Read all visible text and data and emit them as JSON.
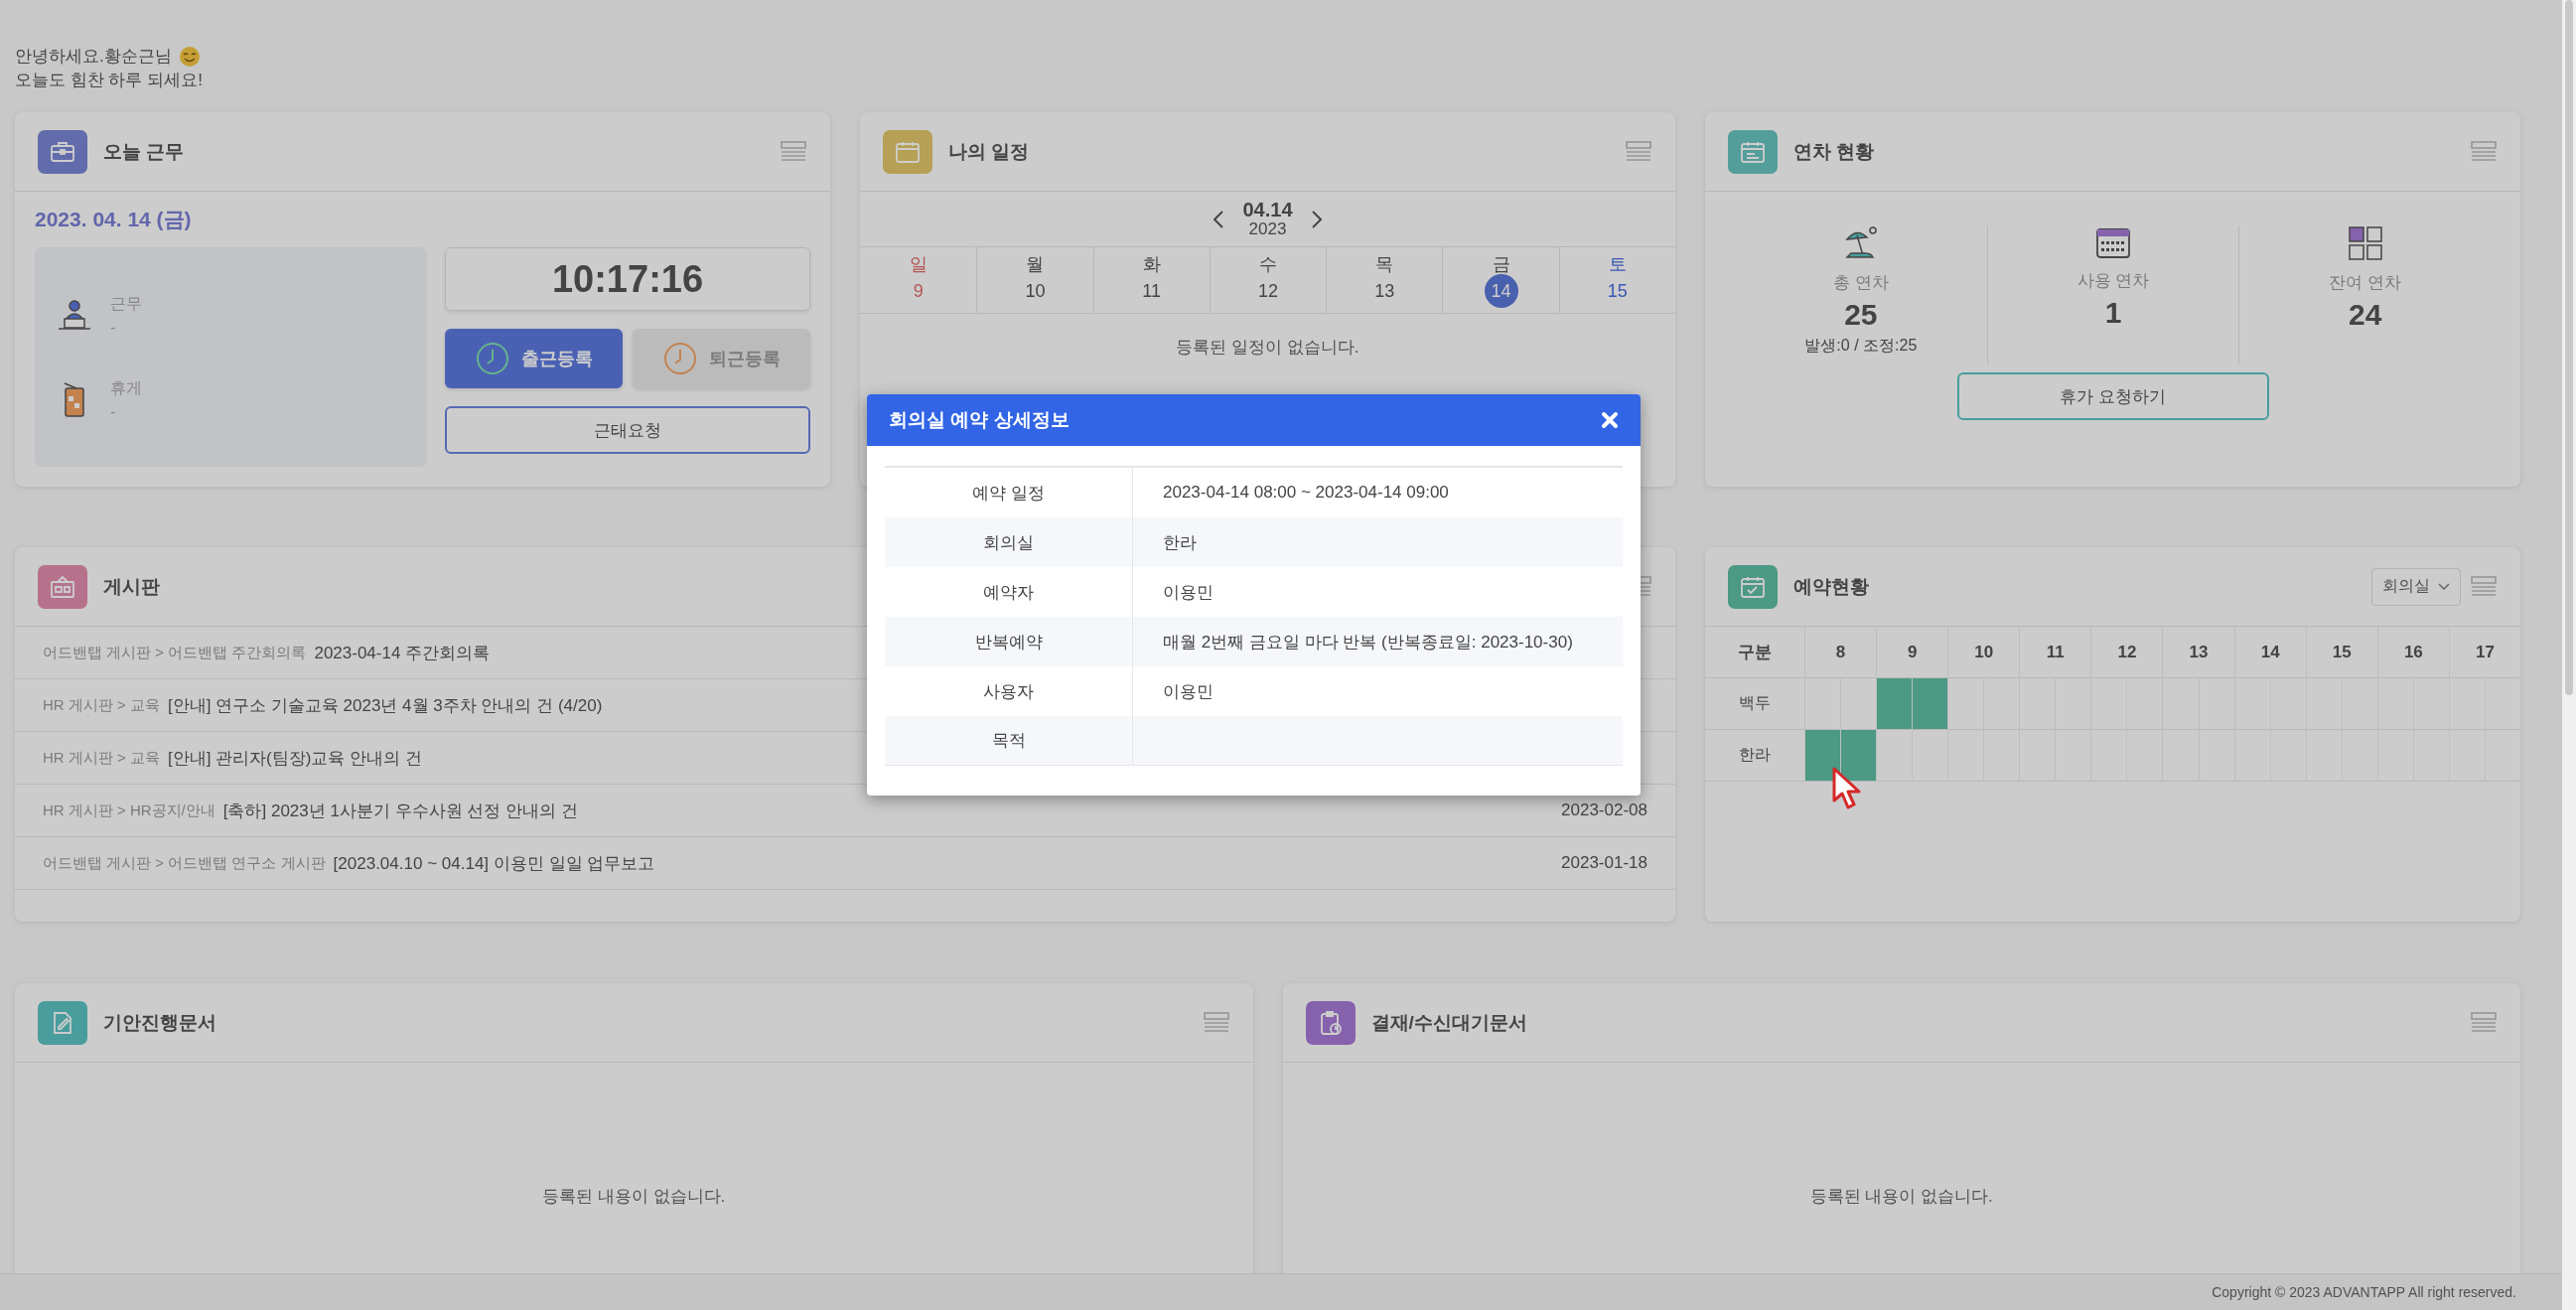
{
  "greeting": {
    "line1": "안녕하세요.황순근님",
    "line2": "오늘도 힘찬 하루 되세요!"
  },
  "work_today": {
    "title": "오늘 근무",
    "date": "2023. 04. 14 (금)",
    "clock": "10:17:16",
    "items": [
      {
        "kind": "work",
        "label": "근무",
        "value": "-"
      },
      {
        "kind": "break",
        "label": "휴게",
        "value": "-"
      }
    ],
    "buttons": [
      {
        "kind": "in",
        "label": "출근등록",
        "disabled": false
      },
      {
        "kind": "out",
        "label": "퇴근등록",
        "disabled": true
      }
    ],
    "request_button": "근태요청"
  },
  "my_schedule": {
    "title": "나의 일정",
    "date": "04.14",
    "year": "2023",
    "empty": "등록된 일정이 없습니다.",
    "days": [
      {
        "kind": "sunday",
        "weekday": "일",
        "day": "9",
        "selected": false
      },
      {
        "kind": "weekday",
        "weekday": "월",
        "day": "10",
        "selected": false
      },
      {
        "kind": "weekday",
        "weekday": "화",
        "day": "11",
        "selected": false
      },
      {
        "kind": "weekday",
        "weekday": "수",
        "day": "12",
        "selected": false
      },
      {
        "kind": "weekday",
        "weekday": "목",
        "day": "13",
        "selected": false
      },
      {
        "kind": "weekday",
        "weekday": "금",
        "day": "14",
        "selected": true
      },
      {
        "kind": "saturday",
        "weekday": "토",
        "day": "15",
        "selected": false
      }
    ]
  },
  "leave": {
    "title": "연차 현황",
    "button": "휴가 요청하기",
    "stats": [
      {
        "kind": "total",
        "label": "총 연차",
        "value": "25",
        "note": "발생:0 / 조정:25"
      },
      {
        "kind": "used",
        "label": "사용 연차",
        "value": "1"
      },
      {
        "kind": "remaining",
        "label": "잔여 연차",
        "value": "24"
      }
    ]
  },
  "board": {
    "title": "게시판",
    "posts": [
      {
        "path": "어드밴탭 게시판 > 어드밴탭 주간회의록",
        "title": "2023-04-14 주간회의록"
      },
      {
        "path": "HR 게시판 > 교육",
        "title": "[안내] 연구소 기술교육 2023년 4월 3주차 안내의 건 (4/20)"
      },
      {
        "path": "HR 게시판 > 교육",
        "title": "[안내] 관리자(팀장)교육 안내의 건"
      },
      {
        "path": "HR 게시판 > HR공지/안내",
        "title": "[축하] 2023년 1사분기 우수사원 선정 안내의 건",
        "date": "2023-02-08"
      },
      {
        "path": "어드밴탭 게시판 > 어드밴탭 연구소 게시판",
        "title": "[2023.04.10 ~ 04.14] 이용민 일일 업무보고",
        "date": "2023-01-18"
      }
    ]
  },
  "reservations": {
    "title": "예약현황",
    "filter": "회의실",
    "columns": [
      "구분",
      "8",
      "9",
      "10",
      "11",
      "12",
      "13",
      "14",
      "15",
      "16",
      "17"
    ],
    "rows": [
      {
        "room": "백두",
        "slots": [
          false,
          false,
          true,
          true,
          false,
          false,
          false,
          false,
          false,
          false,
          false,
          false,
          false,
          false,
          false,
          false,
          false,
          false,
          false,
          false
        ]
      },
      {
        "room": "한라",
        "slots": [
          true,
          true,
          false,
          false,
          false,
          false,
          false,
          false,
          false,
          false,
          false,
          false,
          false,
          false,
          false,
          false,
          false,
          false,
          false,
          false
        ]
      }
    ]
  },
  "drafts": {
    "title": "기안진행문서",
    "empty": "등록된 내용이 없습니다."
  },
  "approvals": {
    "title": "결재/수신대기문서",
    "empty": "등록된 내용이 없습니다."
  },
  "footer": "Copyright © 2023 ADVANTAPP All right reserved.",
  "modal": {
    "title": "회의실 예약 상세정보",
    "rows": [
      {
        "label": "예약 일정",
        "value": "2023-04-14 08:00 ~ 2023-04-14 09:00"
      },
      {
        "label": "회의실",
        "value": "한라"
      },
      {
        "label": "예약자",
        "value": "이용민"
      },
      {
        "label": "반복예약",
        "value": "매월 2번째 금요일 마다 반복 (반복종료일: 2023-10-30)"
      },
      {
        "label": "사용자",
        "value": "이용민"
      },
      {
        "label": "목적"
      }
    ]
  }
}
